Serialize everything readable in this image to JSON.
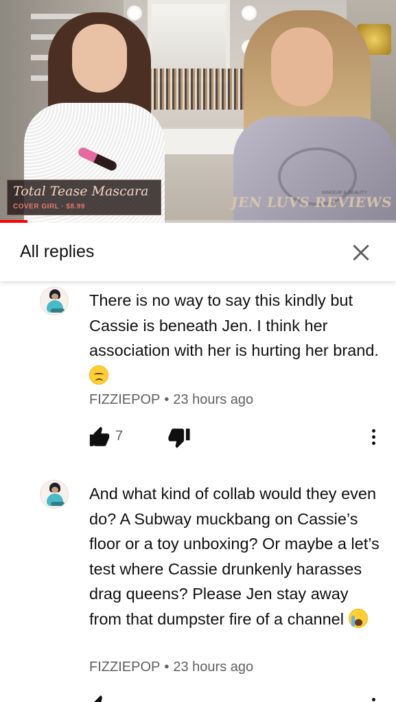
{
  "video": {
    "overlay_title": "Total Tease Mascara",
    "overlay_subtitle": "COVER GIRL · $8.99",
    "watermark": "JEN LUVS REVIEWS",
    "watermark_small": "MAKEUP & BEAUTY",
    "progress_fraction": 0.07,
    "progress_color": "#ff0000"
  },
  "replies_header": {
    "title": "All replies",
    "close_icon": "close-icon"
  },
  "comments": [
    {
      "text_main": "There is no way to say this kindly but Cassie is beneath Jen. I think her association with her is hurting her brand.",
      "emoji": "disappointed-face-emoji",
      "author": "FIZZIEPOP",
      "time": "23 hours ago",
      "likes": "7",
      "icons": [
        "thumbs-up-icon",
        "thumbs-down-icon",
        "more-vert-icon"
      ]
    },
    {
      "text_main": "And what kind of collab would they even do? A Subway muckbang on Cassie’s floor or a toy unboxing? Or maybe a let’s test where Cassie drunkenly harasses drag queens? Please Jen stay away from that dumpster fire of a channel",
      "emoji": "loudly-crying-face-emoji",
      "author": "FIZZIEPOP",
      "time": "23 hours ago",
      "likes": "",
      "icons": [
        "thumbs-up-icon",
        "thumbs-down-icon",
        "more-vert-icon"
      ]
    }
  ],
  "separator": "•"
}
